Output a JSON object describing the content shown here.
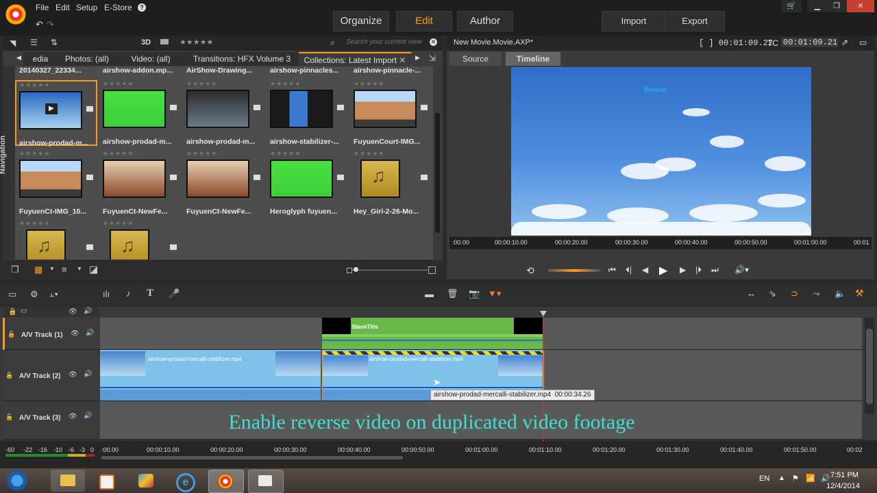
{
  "menu": {
    "items": [
      "File",
      "Edit",
      "Setup",
      "E-Store"
    ]
  },
  "modes": {
    "organize": "Organize",
    "edit": "Edit",
    "author": "Author"
  },
  "actions": {
    "import": "Import",
    "export": "Export"
  },
  "library": {
    "view_3d": "3D",
    "rating_filter": "★★★★★",
    "search_placeholder": "Search your current view",
    "tabs": [
      "edia",
      "Photos: (all)",
      "Video: (all)",
      "Transitions: HFX Volume 3",
      "Collections: Latest Import"
    ],
    "top_row_captions": [
      "20140327_22334...",
      "airshow-addon.mp...",
      "AirShow-Drawing...",
      "airshow-pinnacles...",
      "airshow-pinnacle-..."
    ],
    "items": [
      {
        "caption": "airshow-prodad-m...",
        "kind": "sky-play"
      },
      {
        "caption": "airshow-prodad-m...",
        "kind": "green"
      },
      {
        "caption": "airshow-prodad-m...",
        "kind": "screen"
      },
      {
        "caption": "airshow-stabilizer-...",
        "kind": "split"
      },
      {
        "caption": "FuyuenCourt-IMG...",
        "kind": "building"
      },
      {
        "caption": "FuyuenCt-IMG_10...",
        "kind": "building"
      },
      {
        "caption": "FuyuenCt-NewFe...",
        "kind": "room"
      },
      {
        "caption": "FuyuenCt-NewFe...",
        "kind": "room"
      },
      {
        "caption": "Heroglyph fuyuen...",
        "kind": "green"
      },
      {
        "caption": "Hey_Girl-2-26-Mo...",
        "kind": "music"
      },
      {
        "caption": "",
        "kind": "music"
      },
      {
        "caption": "",
        "kind": "music"
      }
    ],
    "nav_label": "Navigation"
  },
  "player": {
    "title": "New Movie.Movie.AXP*",
    "duration": "[ ] 00:01:09.22",
    "tc_label": "TC",
    "tc_value": "00:01:09.21",
    "tabs": {
      "source": "Source",
      "timeline": "Timeline"
    },
    "overlay_text": "Reverse",
    "ruler": [
      ":00.00",
      "00:00:10.00",
      "00:00:20.00",
      "00:00:30.00",
      "00:00:40.00",
      "00:00:50.00",
      "00:01:00.00",
      "00:01"
    ]
  },
  "timeline": {
    "tracks": [
      {
        "name": "A/V Track (1)"
      },
      {
        "name": "A/V Track (2)"
      },
      {
        "name": "A/V Track (3)"
      }
    ],
    "title_clip": "BlankTitle",
    "clip_a": "airshow-prodad-mercalli-stabilizer.mp4",
    "clip_b": "airshow-prodad-mercalli-stabilizer.mp4",
    "tooltip": "airshow-prodad-mercalli-stabilizer.mp4  00:00:34.26",
    "caption": "Enable reverse video on duplicated video footage",
    "ruler": [
      ":00.00",
      "00:00:10.00",
      "00:00:20.00",
      "00:00:30.00",
      "00:00:40.00",
      "00:00:50.00",
      "00:01:00.00",
      "00:01:10.00",
      "00:01:20.00",
      "00:01:30.00",
      "00:01:40.00",
      "00:01:50.00",
      "00:02"
    ],
    "meter_labels": [
      "-60",
      "-22",
      "-16",
      "-10",
      "-6",
      "-3",
      "0"
    ]
  },
  "taskbar": {
    "lang": "EN",
    "time": "7:51 PM",
    "date": "12/4/2014"
  },
  "colors": {
    "accent": "#ff9a1f",
    "caption": "#3fe0d0"
  }
}
